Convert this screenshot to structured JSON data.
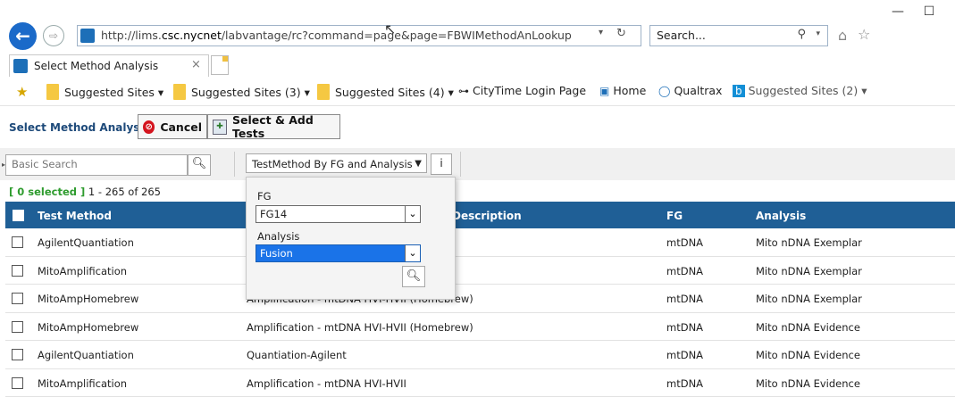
{
  "browser": {
    "url_prefix": "http://lims.",
    "url_domain": "csc.nycnet",
    "url_suffix": "/labvantage/rc?command=page&page=FBWIMethodAnLookup",
    "search_placeholder": "Search...",
    "minimize": "—",
    "maximize": "☐",
    "tab_title": "Select Method Analysis",
    "favorites": [
      {
        "label": "Suggested Sites ▾",
        "icon": "folder"
      },
      {
        "label": "Suggested Sites (3) ▾",
        "icon": "folder"
      },
      {
        "label": "Suggested Sites (4) ▾",
        "icon": "folder"
      },
      {
        "label": "CityTime Login Page",
        "icon": "link-icon"
      },
      {
        "label": "Home",
        "icon": "page-icon"
      },
      {
        "label": "Qualtrax",
        "icon": "qualtrax-icon"
      },
      {
        "label": "Suggested Sites (2) ▾",
        "icon": "bing-icon"
      }
    ]
  },
  "toolbar": {
    "title": "Select Method Analysis",
    "cancel_label": "Cancel",
    "select_add_label": "Select & Add Tests"
  },
  "search": {
    "placeholder": "Basic Search",
    "lookup_label": "TestMethod By FG and Analysis",
    "info_label": "i"
  },
  "selection": {
    "selected": "[ 0 selected ]",
    "range": "1 - 265 of 265"
  },
  "popup": {
    "fg_label": "FG",
    "fg_value": "FG14",
    "analysis_label": "Analysis",
    "analysis_value": "Fusion"
  },
  "table": {
    "headers": [
      "Test Method",
      "Description",
      "FG",
      "Analysis"
    ],
    "rows": [
      {
        "method": "AgilentQuantiation",
        "desc": "",
        "fg": "mtDNA",
        "analysis": "Mito nDNA Exemplar"
      },
      {
        "method": "MitoAmplification",
        "desc": "",
        "fg": "mtDNA",
        "analysis": "Mito nDNA Exemplar"
      },
      {
        "method": "MitoAmpHomebrew",
        "desc": "Amplification - mtDNA HVI-HVII (Homebrew)",
        "fg": "mtDNA",
        "analysis": "Mito nDNA Exemplar"
      },
      {
        "method": "MitoAmpHomebrew",
        "desc": "Amplification - mtDNA HVI-HVII (Homebrew)",
        "fg": "mtDNA",
        "analysis": "Mito nDNA Evidence"
      },
      {
        "method": "AgilentQuantiation",
        "desc": "Quantiation-Agilent",
        "fg": "mtDNA",
        "analysis": "Mito nDNA Evidence"
      },
      {
        "method": "MitoAmplification",
        "desc": "Amplification - mtDNA HVI-HVII",
        "fg": "mtDNA",
        "analysis": "Mito nDNA Evidence"
      }
    ]
  },
  "colors": {
    "header_blue": "#1f5f96",
    "selected_green": "#2f9c2f",
    "cancel_red": "#d4141e"
  }
}
